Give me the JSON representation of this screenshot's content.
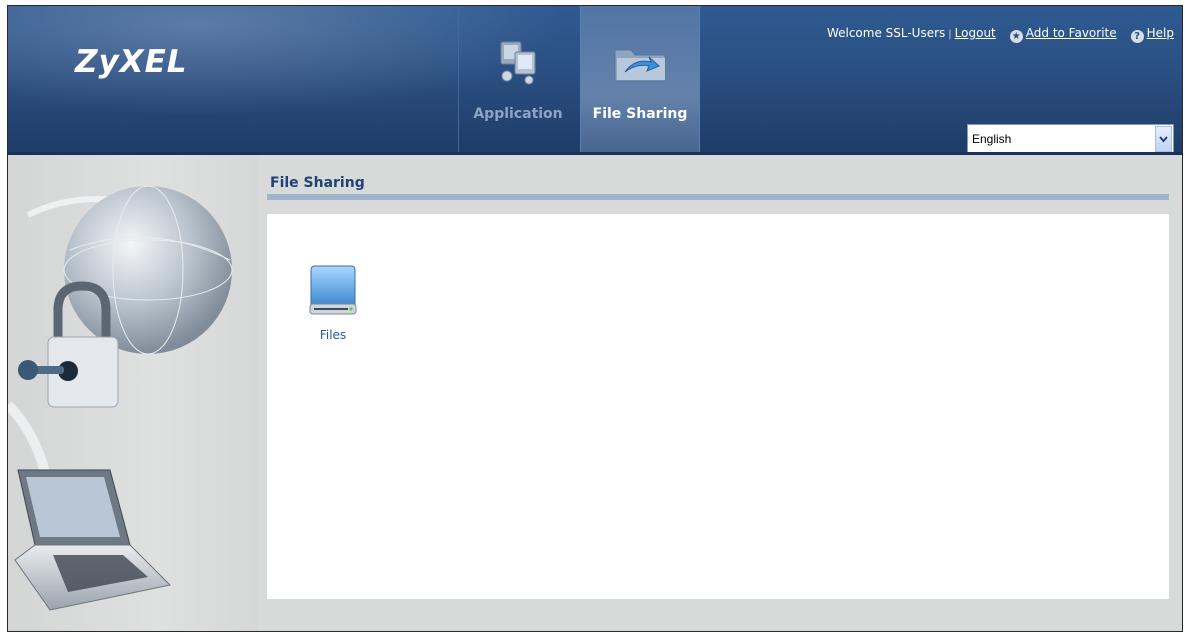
{
  "app": {
    "logo_text": "ZyXEL"
  },
  "nav": {
    "tabs": [
      {
        "label": "Application",
        "icon": "application-icon",
        "active": false
      },
      {
        "label": "File Sharing",
        "icon": "file-sharing-icon",
        "active": true
      }
    ]
  },
  "top_links": {
    "welcome": "Welcome SSL-Users",
    "separator": "|",
    "logout": "Logout",
    "add_favorite": "Add to Favorite",
    "help": "Help"
  },
  "language": {
    "selected": "English"
  },
  "main": {
    "title": "File Sharing",
    "items": [
      {
        "label": "Files",
        "icon": "hard-drive-icon"
      }
    ]
  },
  "colors": {
    "header_blue": "#2a4f82",
    "title_blue": "#1e4475",
    "link_blue": "#1f5aa0",
    "rule_gray_blue": "#9fb4c8"
  }
}
